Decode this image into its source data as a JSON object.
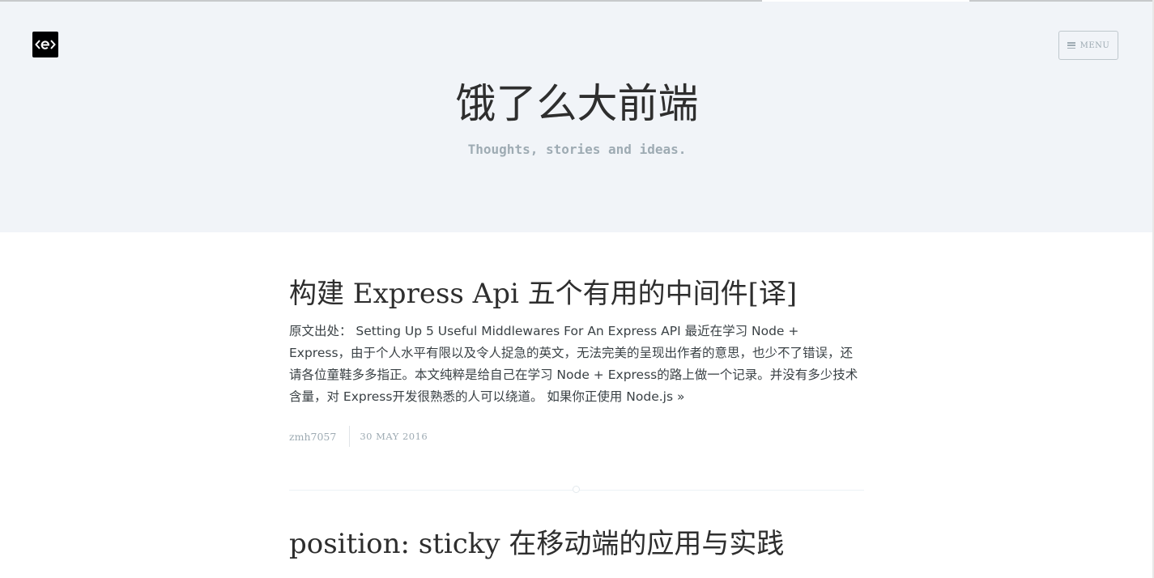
{
  "header": {
    "logo_text": "<e>",
    "menu_label": "MENU",
    "blog_title": "饿了么大前端",
    "blog_description": "Thoughts, stories and ideas."
  },
  "posts": [
    {
      "title": "构建 Express Api 五个有用的中间件[译]",
      "excerpt": "原文出处： Setting Up 5 Useful Middlewares For An Express API 最近在学习 Node + Express，由于个人水平有限以及令人捉急的英文，无法完美的呈现出作者的意思，也少不了错误，还请各位童鞋多多指正。本文纯粹是给自己在学习 Node + Express的路上做一个记录。并没有多少技术含量，对 Express开发很熟悉的人可以绕道。 如果你正使用 Node.js",
      "read_more": "»",
      "author": "zmh7057",
      "date": "30 MAY 2016"
    },
    {
      "title": "position: sticky 在移动端的应用与实践"
    }
  ],
  "colors": {
    "header_bg": "#f1f4f8",
    "title": "#2e2e2e",
    "text": "#3a4145",
    "muted": "#9eabb3"
  }
}
